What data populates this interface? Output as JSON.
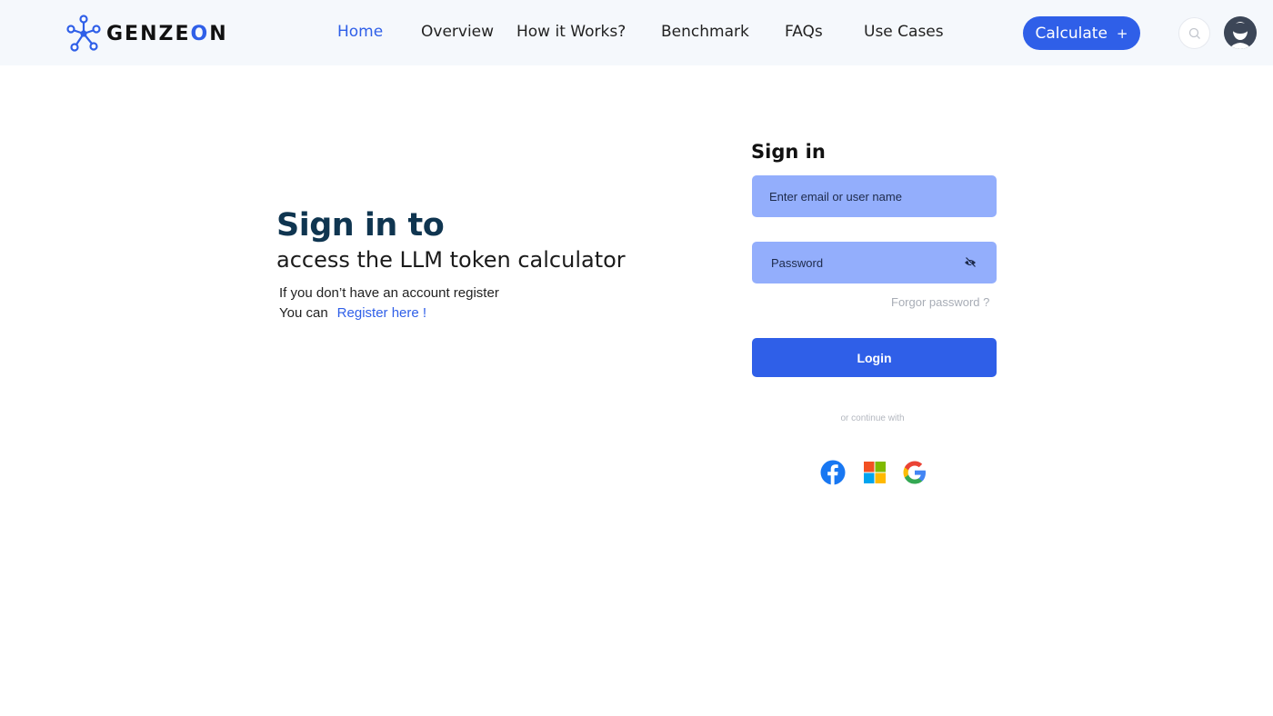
{
  "brand": {
    "logo_text_pre": "GENZE",
    "logo_text_o": "O",
    "logo_text_post": "N"
  },
  "nav": {
    "home": "Home",
    "overview": "Overview",
    "how": "How it Works?",
    "benchmark": "Benchmark",
    "faqs": "FAQs",
    "use_cases": "Use Cases"
  },
  "header": {
    "calculate_label": "Calculate",
    "calculate_icon": "+"
  },
  "hero": {
    "title": "Sign in to",
    "subtitle": "access the LLM token calculator",
    "line1": "If you don’t have an account register",
    "line2_prefix": "You can",
    "register_link": "Register here !"
  },
  "form": {
    "title": "Sign in",
    "email_placeholder": "Enter email or user name",
    "password_placeholder": "Password",
    "forgot": "Forgor password ?",
    "login_label": "Login",
    "continue_with": "or continue with"
  },
  "icons": {
    "logo": "genzeon-molecule-icon",
    "search": "search-icon",
    "avatar": "user-avatar",
    "eye": "eye-slash-icon",
    "facebook": "facebook-icon",
    "microsoft": "microsoft-icon",
    "google": "google-icon"
  },
  "colors": {
    "accent": "#2f5fe8",
    "field_bg": "#93aefc",
    "title": "#0f3550",
    "header_bg": "#f5f8fc"
  }
}
